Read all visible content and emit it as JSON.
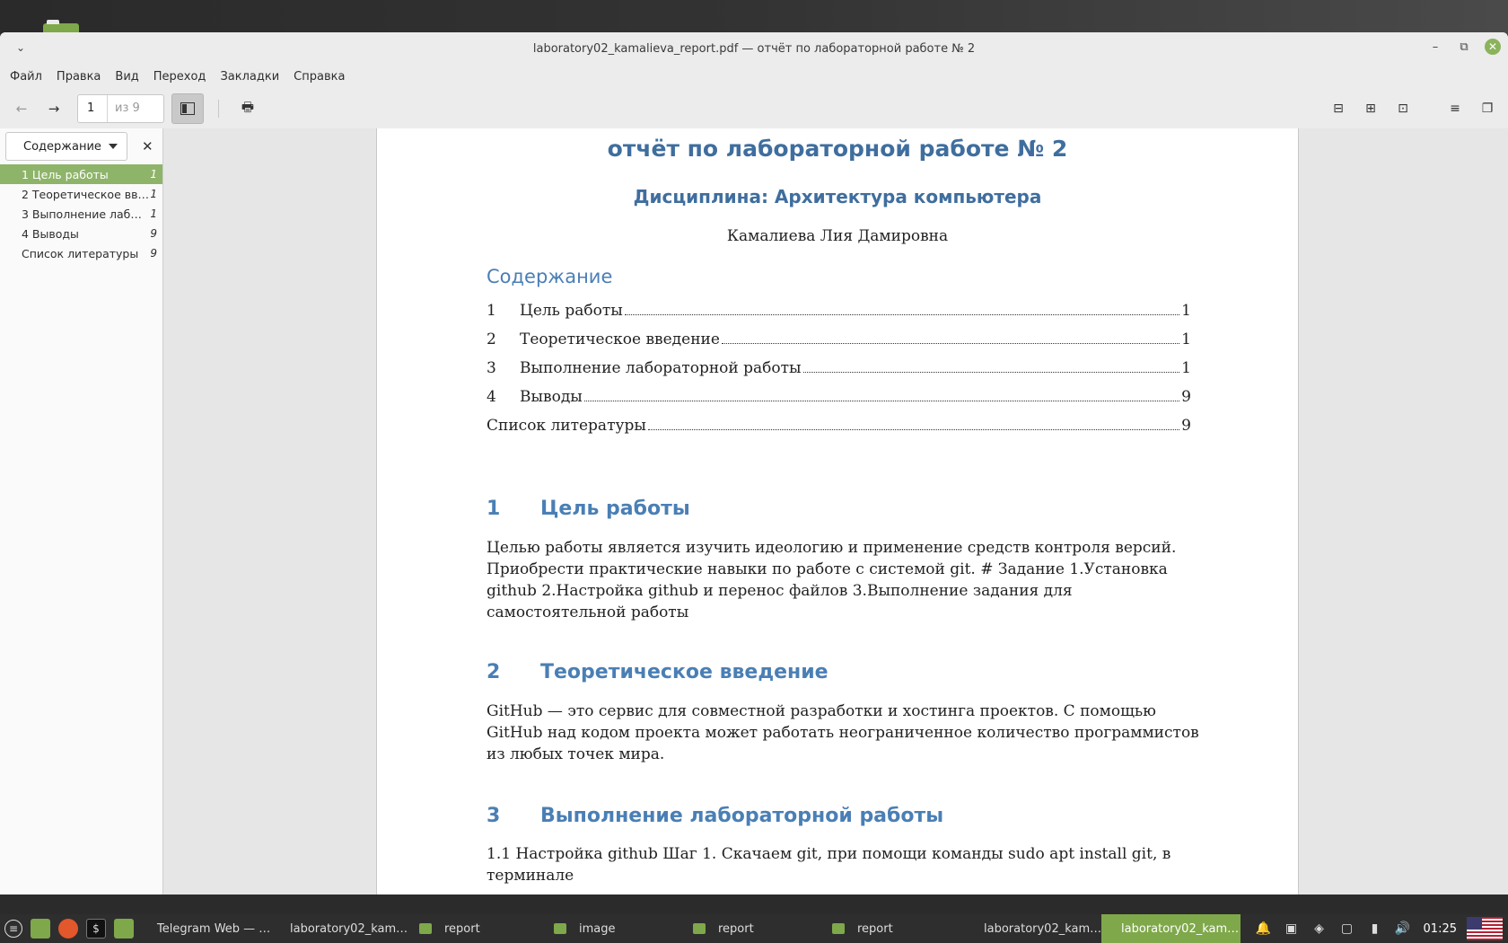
{
  "window": {
    "title": "laboratory02_kamalieva_report.pdf — отчёт по лабораторной работе № 2"
  },
  "menubar": [
    "Файл",
    "Правка",
    "Вид",
    "Переход",
    "Закладки",
    "Справка"
  ],
  "toolbar": {
    "page_current": "1",
    "page_of": "из 9"
  },
  "sidebar": {
    "dropdown_label": "Содержание",
    "items": [
      {
        "label": "1 Цель работы",
        "page": "1"
      },
      {
        "label": "2 Теоретическое вв…",
        "page": "1"
      },
      {
        "label": "3 Выполнение лаб…",
        "page": "1"
      },
      {
        "label": "4 Выводы",
        "page": "9"
      },
      {
        "label": "Список литературы",
        "page": "9"
      }
    ]
  },
  "document": {
    "title": "отчёт по лабораторной работе № 2",
    "subtitle": "Дисциплина: Архитектура компьютера",
    "author": "Камалиева Лия Дамировна",
    "toc_heading": "Содержание",
    "toc": [
      {
        "num": "1",
        "label": "Цель работы",
        "page": "1"
      },
      {
        "num": "2",
        "label": "Теоретическое введение",
        "page": "1"
      },
      {
        "num": "3",
        "label": "Выполнение лабораторной работы",
        "page": "1"
      },
      {
        "num": "4",
        "label": "Выводы",
        "page": "9"
      },
      {
        "num": "",
        "label": "Список литературы",
        "page": "9"
      }
    ],
    "sections": [
      {
        "num": "1",
        "title": "Цель работы",
        "text": "Целью работы является изучить идеологию и применение средств контроля версий. Приобрести практические навыки по работе с системой git. # Задание 1.Установка github 2.Настройка github и перенос файлов 3.Выполнение задания для самостоятельной работы"
      },
      {
        "num": "2",
        "title": "Теоретическое введение",
        "text": "GitHub — это сервис для совместной разработки и хостинга проектов. С помощью GitHub над кодом проекта может работать неограниченное количество программистов из любых точек мира."
      },
      {
        "num": "3",
        "title": "Выполнение лабораторной работы",
        "text": "1.1 Настройка github Шаг 1. Скачаем git, при помощи команды sudo apt install git, в терминале"
      }
    ]
  },
  "taskbar": {
    "tasks": [
      {
        "label": "Telegram Web — …",
        "active": false
      },
      {
        "label": "laboratory02_kam…",
        "active": false
      },
      {
        "label": "report",
        "active": false
      },
      {
        "label": "image",
        "active": false
      },
      {
        "label": "report",
        "active": false
      },
      {
        "label": "report",
        "active": false
      },
      {
        "label": "laboratory02_kam…",
        "active": false
      },
      {
        "label": "laboratory02_kam…",
        "active": true
      }
    ],
    "clock": "01:25"
  },
  "colors": {
    "accent": "#8eb46a",
    "heading_blue": "#4a7fb5",
    "title_blue": "#3f6e9e"
  }
}
